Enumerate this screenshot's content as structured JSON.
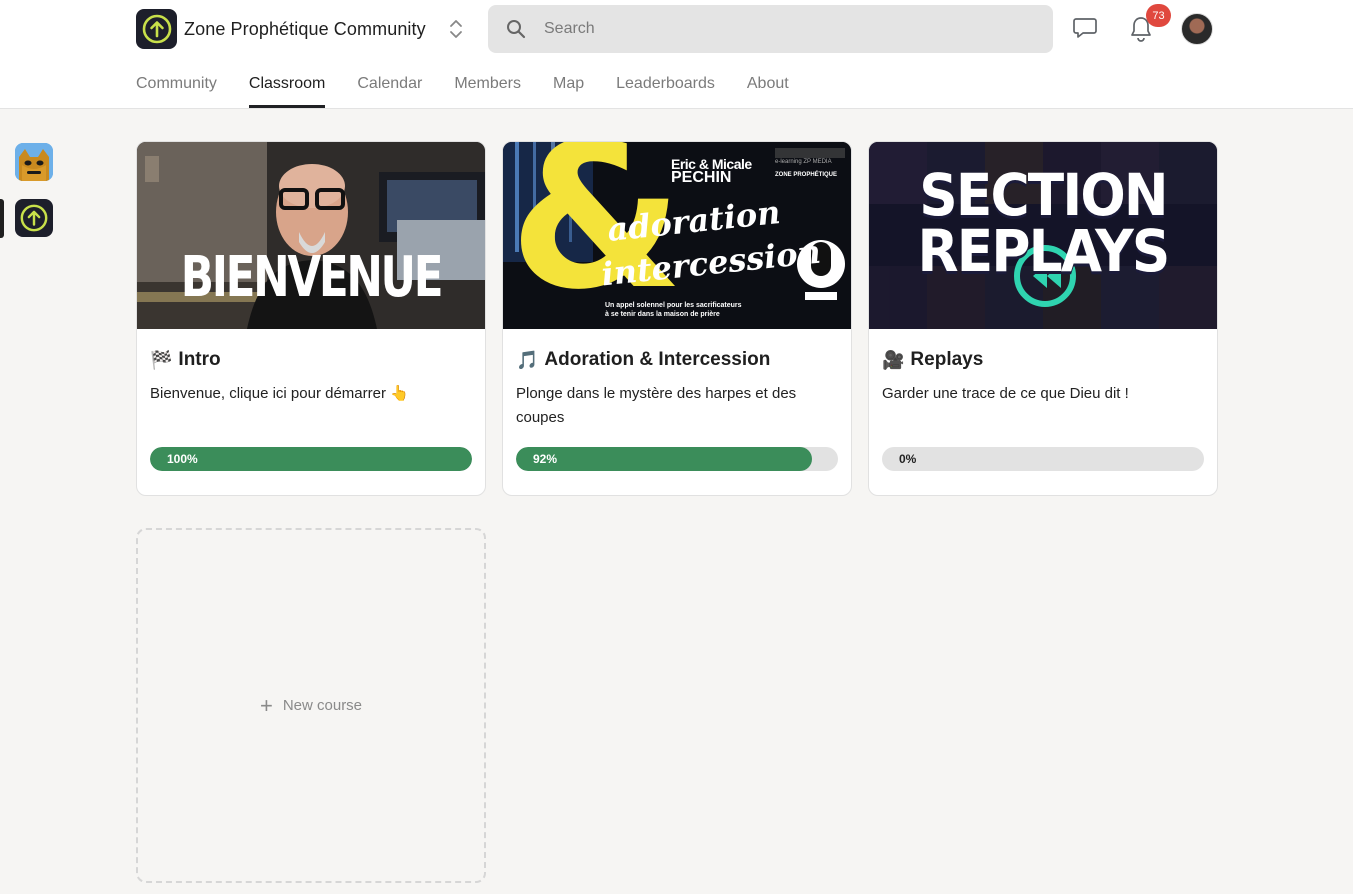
{
  "header": {
    "community_name": "Zone Prophétique Community",
    "search_placeholder": "Search",
    "notifications_count": "73",
    "icons": {
      "logo": "arrow-up-circle-icon",
      "switcher": "chevron-up-down-icon",
      "search": "search-icon",
      "chat": "chat-bubble-icon",
      "notifications": "bell-icon"
    }
  },
  "tabs": [
    {
      "label": "Community",
      "active": false
    },
    {
      "label": "Classroom",
      "active": true
    },
    {
      "label": "Calendar",
      "active": false
    },
    {
      "label": "Members",
      "active": false
    },
    {
      "label": "Map",
      "active": false
    },
    {
      "label": "Leaderboards",
      "active": false
    },
    {
      "label": "About",
      "active": false
    }
  ],
  "rail": {
    "items": [
      {
        "name": "cat-community-icon",
        "active": false
      },
      {
        "name": "zone-prophetique-icon",
        "active": true
      }
    ]
  },
  "courses": [
    {
      "emoji": "🏁",
      "title": "Intro",
      "description": "Bienvenue, clique ici pour démarrer 👆",
      "progress": 100,
      "progress_label": "100%",
      "cover_text": "BIENVENUE"
    },
    {
      "emoji": "🎵",
      "title": "Adoration & Intercession",
      "description": "Plonge dans le mystère des harpes et des coupes",
      "progress": 92,
      "progress_label": "92%",
      "cover_text": {
        "authors_line1": "Eric & Micale",
        "authors_line2": "PECHIN",
        "brand_small": "e-learning ZP MEDIA",
        "brand": "ZONE PROPHÉTIQUE",
        "ampersand": "&",
        "script1": "adoration",
        "script2": "intercession",
        "tagline1": "Un appel solennel pour les sacrificateurs",
        "tagline2": "à se tenir dans la maison de prière"
      }
    },
    {
      "emoji": "🎥",
      "title": "Replays",
      "description": "Garder une trace de ce que Dieu dit !",
      "progress": 0,
      "progress_label": "0%",
      "cover_text": {
        "line1": "SECTION",
        "line2": "REPLAYS"
      }
    }
  ],
  "new_course": {
    "label": "New course"
  }
}
